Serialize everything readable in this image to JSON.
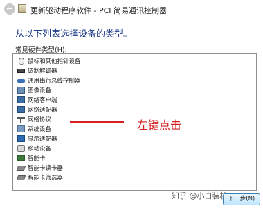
{
  "window": {
    "title": "更新驱动程序软件 - PCI 简易通讯控制器"
  },
  "instruction": "从以下列表选择设备的类型。",
  "list_label": "常见硬件类型(H):",
  "hardware_types": [
    {
      "label": "鼠标和其他指针设备",
      "icon": "mouse-icon"
    },
    {
      "label": "调制解调器",
      "icon": "modem-icon"
    },
    {
      "label": "通用串行总线控制器",
      "icon": "usb-icon"
    },
    {
      "label": "图像设备",
      "icon": "image-device-icon"
    },
    {
      "label": "网络客户端",
      "icon": "network-client-icon"
    },
    {
      "label": "网络适配器",
      "icon": "network-adapter-icon"
    },
    {
      "label": "网络协议",
      "icon": "network-protocol-icon"
    },
    {
      "label": "系统设备",
      "icon": "system-device-icon"
    },
    {
      "label": "显示适配器",
      "icon": "display-adapter-icon"
    },
    {
      "label": "移动设备",
      "icon": "mobile-device-icon"
    },
    {
      "label": "智能卡",
      "icon": "smart-card-icon"
    },
    {
      "label": "智能卡读卡器",
      "icon": "card-reader-icon"
    },
    {
      "label": "智能卡筛选器",
      "icon": "card-filter-icon"
    }
  ],
  "annotation": "左键点击",
  "watermark": "知乎 @小白装机",
  "next_button": "下一步(N)"
}
